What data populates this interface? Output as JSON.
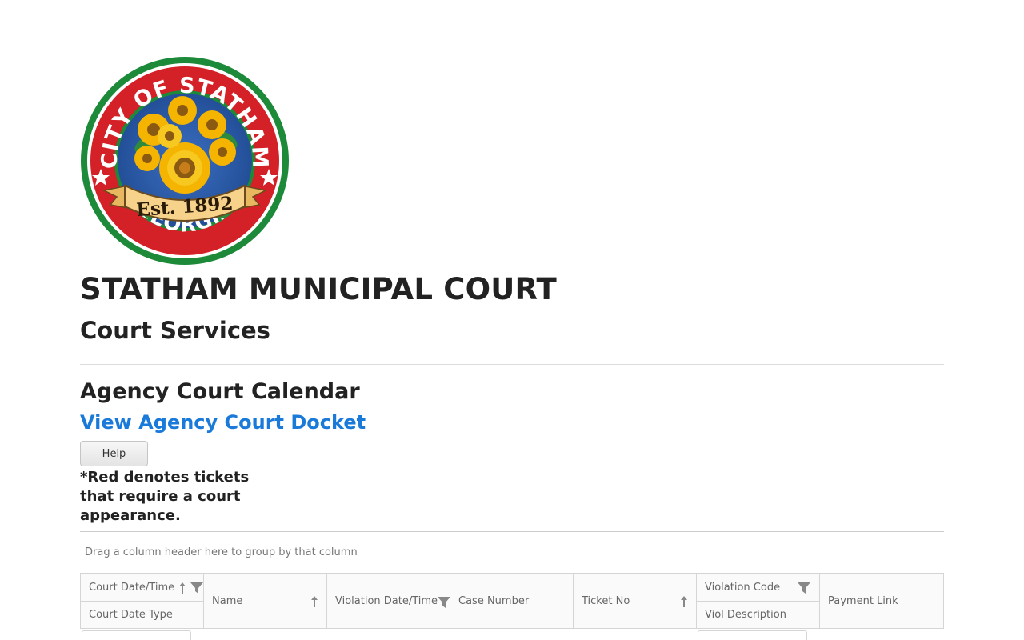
{
  "seal": {
    "top_text": "CITY OF STATHAM",
    "est_text": "Est. 1892",
    "bottom_text": "GEORGIA",
    "colors": {
      "ring": "#1d8a3a",
      "band": "#d42027",
      "inner": "#2f5fae",
      "ribbon": "#f7d28a"
    }
  },
  "header": {
    "title": "STATHAM MUNICIPAL COURT",
    "subtitle": "Court Services"
  },
  "section": {
    "title": "Agency Court Calendar",
    "docket_link": "View Agency Court Docket",
    "help_label": "Help",
    "note": "*Red denotes tickets that require a court appearance."
  },
  "grid": {
    "group_hint": "Drag a column header here to group by that column",
    "columns": {
      "court_date_time": "Court Date/Time",
      "court_date_type": "Court Date Type",
      "name": "Name",
      "violation_date_time": "Violation Date/Time",
      "case_number": "Case Number",
      "ticket_no": "Ticket No",
      "violation_code": "Violation Code",
      "viol_description": "Viol Description",
      "payment_link": "Payment Link"
    }
  },
  "colors": {
    "link": "#1a7ad9",
    "text": "#222222",
    "muted": "#666666",
    "border": "#d5d5d5"
  }
}
